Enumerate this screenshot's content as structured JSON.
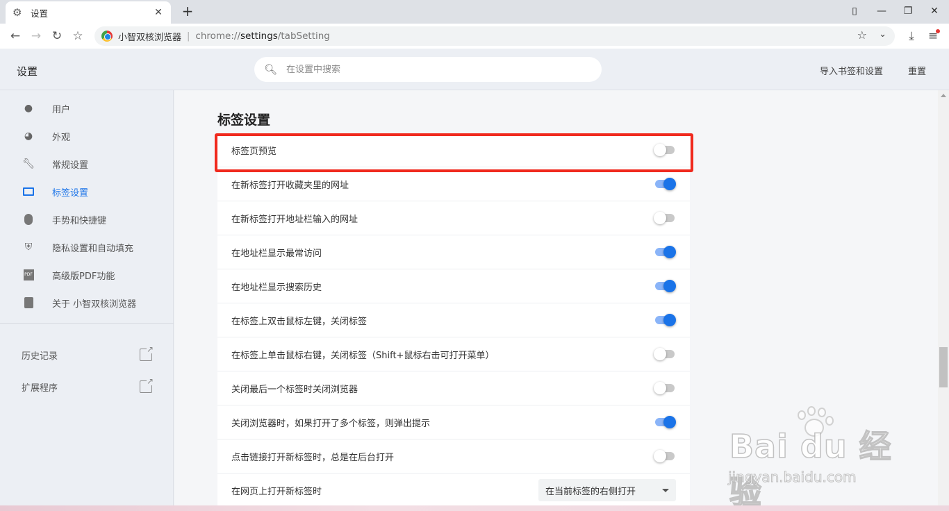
{
  "tab": {
    "title": "设置",
    "icon": "gear-icon"
  },
  "toolbar": {
    "brand": "小智双核浏览器",
    "url_scheme": "chrome://",
    "url_host": "settings",
    "url_path": "/tabSetting"
  },
  "header": {
    "title": "设置",
    "search_placeholder": "在设置中搜索",
    "import_label": "导入书签和设置",
    "reset_label": "重置"
  },
  "sidebar": {
    "items": [
      {
        "label": "用户",
        "icon": "person-icon"
      },
      {
        "label": "外观",
        "icon": "palette-icon"
      },
      {
        "label": "常规设置",
        "icon": "wrench-icon"
      },
      {
        "label": "标签设置",
        "icon": "tab-icon",
        "active": true
      },
      {
        "label": "手势和快捷键",
        "icon": "mouse-icon"
      },
      {
        "label": "隐私设置和自动填充",
        "icon": "shield-icon"
      },
      {
        "label": "高级版PDF功能",
        "icon": "pdf-icon"
      },
      {
        "label": "关于 小智双核浏览器",
        "icon": "clipboard-icon"
      }
    ],
    "links": [
      {
        "label": "历史记录",
        "icon": "open-external-icon"
      },
      {
        "label": "扩展程序",
        "icon": "open-external-icon"
      }
    ]
  },
  "main": {
    "section_title": "标签设置",
    "rows": [
      {
        "label": "标签页预览",
        "on": false
      },
      {
        "label": "在新标签打开收藏夹里的网址",
        "on": true
      },
      {
        "label": "在新标签打开地址栏输入的网址",
        "on": false
      },
      {
        "label": "在地址栏显示最常访问",
        "on": true
      },
      {
        "label": "在地址栏显示搜索历史",
        "on": true
      },
      {
        "label": "在标签上双击鼠标左键，关闭标签",
        "on": true
      },
      {
        "label": "在标签上单击鼠标右键，关闭标签（Shift+鼠标右击可打开菜单）",
        "on": false
      },
      {
        "label": "关闭最后一个标签时关闭浏览器",
        "on": false
      },
      {
        "label": "关闭浏览器时，如果打开了多个标签，则弹出提示",
        "on": true
      },
      {
        "label": "点击链接打开新标签时，总是在后台打开",
        "on": false
      }
    ],
    "select_row": {
      "label": "在网页上打开新标签时",
      "value": "在当前标签的右侧打开"
    }
  },
  "watermark": {
    "brand": "Bai du 经验",
    "url": "jingyan.baidu.com"
  },
  "colors": {
    "accent": "#1a73e8",
    "highlight_border": "#f02a1e"
  }
}
